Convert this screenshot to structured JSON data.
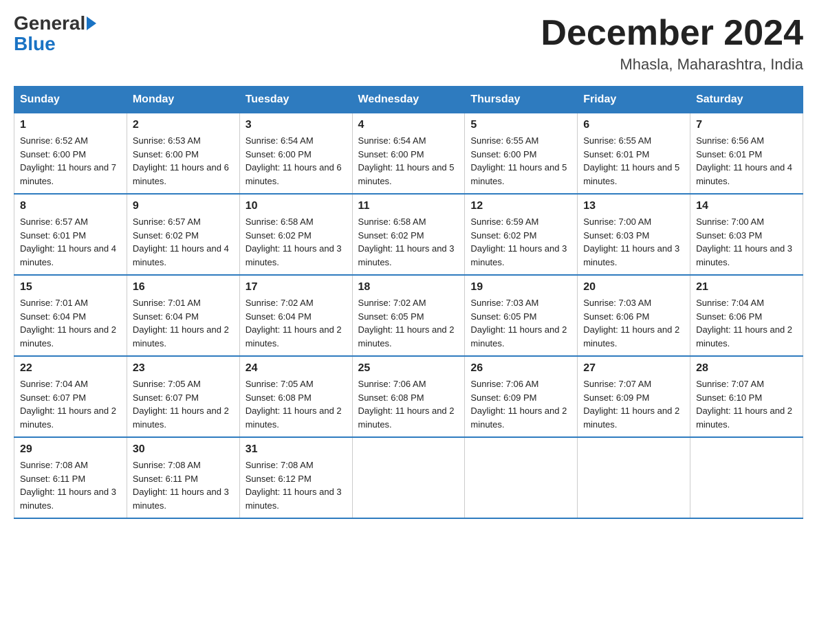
{
  "header": {
    "logo_general": "General",
    "logo_blue": "Blue",
    "title": "December 2024",
    "subtitle": "Mhasla, Maharashtra, India"
  },
  "days_of_week": [
    "Sunday",
    "Monday",
    "Tuesday",
    "Wednesday",
    "Thursday",
    "Friday",
    "Saturday"
  ],
  "weeks": [
    [
      {
        "day": "1",
        "sunrise": "6:52 AM",
        "sunset": "6:00 PM",
        "daylight": "11 hours and 7 minutes."
      },
      {
        "day": "2",
        "sunrise": "6:53 AM",
        "sunset": "6:00 PM",
        "daylight": "11 hours and 6 minutes."
      },
      {
        "day": "3",
        "sunrise": "6:54 AM",
        "sunset": "6:00 PM",
        "daylight": "11 hours and 6 minutes."
      },
      {
        "day": "4",
        "sunrise": "6:54 AM",
        "sunset": "6:00 PM",
        "daylight": "11 hours and 5 minutes."
      },
      {
        "day": "5",
        "sunrise": "6:55 AM",
        "sunset": "6:00 PM",
        "daylight": "11 hours and 5 minutes."
      },
      {
        "day": "6",
        "sunrise": "6:55 AM",
        "sunset": "6:01 PM",
        "daylight": "11 hours and 5 minutes."
      },
      {
        "day": "7",
        "sunrise": "6:56 AM",
        "sunset": "6:01 PM",
        "daylight": "11 hours and 4 minutes."
      }
    ],
    [
      {
        "day": "8",
        "sunrise": "6:57 AM",
        "sunset": "6:01 PM",
        "daylight": "11 hours and 4 minutes."
      },
      {
        "day": "9",
        "sunrise": "6:57 AM",
        "sunset": "6:02 PM",
        "daylight": "11 hours and 4 minutes."
      },
      {
        "day": "10",
        "sunrise": "6:58 AM",
        "sunset": "6:02 PM",
        "daylight": "11 hours and 3 minutes."
      },
      {
        "day": "11",
        "sunrise": "6:58 AM",
        "sunset": "6:02 PM",
        "daylight": "11 hours and 3 minutes."
      },
      {
        "day": "12",
        "sunrise": "6:59 AM",
        "sunset": "6:02 PM",
        "daylight": "11 hours and 3 minutes."
      },
      {
        "day": "13",
        "sunrise": "7:00 AM",
        "sunset": "6:03 PM",
        "daylight": "11 hours and 3 minutes."
      },
      {
        "day": "14",
        "sunrise": "7:00 AM",
        "sunset": "6:03 PM",
        "daylight": "11 hours and 3 minutes."
      }
    ],
    [
      {
        "day": "15",
        "sunrise": "7:01 AM",
        "sunset": "6:04 PM",
        "daylight": "11 hours and 2 minutes."
      },
      {
        "day": "16",
        "sunrise": "7:01 AM",
        "sunset": "6:04 PM",
        "daylight": "11 hours and 2 minutes."
      },
      {
        "day": "17",
        "sunrise": "7:02 AM",
        "sunset": "6:04 PM",
        "daylight": "11 hours and 2 minutes."
      },
      {
        "day": "18",
        "sunrise": "7:02 AM",
        "sunset": "6:05 PM",
        "daylight": "11 hours and 2 minutes."
      },
      {
        "day": "19",
        "sunrise": "7:03 AM",
        "sunset": "6:05 PM",
        "daylight": "11 hours and 2 minutes."
      },
      {
        "day": "20",
        "sunrise": "7:03 AM",
        "sunset": "6:06 PM",
        "daylight": "11 hours and 2 minutes."
      },
      {
        "day": "21",
        "sunrise": "7:04 AM",
        "sunset": "6:06 PM",
        "daylight": "11 hours and 2 minutes."
      }
    ],
    [
      {
        "day": "22",
        "sunrise": "7:04 AM",
        "sunset": "6:07 PM",
        "daylight": "11 hours and 2 minutes."
      },
      {
        "day": "23",
        "sunrise": "7:05 AM",
        "sunset": "6:07 PM",
        "daylight": "11 hours and 2 minutes."
      },
      {
        "day": "24",
        "sunrise": "7:05 AM",
        "sunset": "6:08 PM",
        "daylight": "11 hours and 2 minutes."
      },
      {
        "day": "25",
        "sunrise": "7:06 AM",
        "sunset": "6:08 PM",
        "daylight": "11 hours and 2 minutes."
      },
      {
        "day": "26",
        "sunrise": "7:06 AM",
        "sunset": "6:09 PM",
        "daylight": "11 hours and 2 minutes."
      },
      {
        "day": "27",
        "sunrise": "7:07 AM",
        "sunset": "6:09 PM",
        "daylight": "11 hours and 2 minutes."
      },
      {
        "day": "28",
        "sunrise": "7:07 AM",
        "sunset": "6:10 PM",
        "daylight": "11 hours and 2 minutes."
      }
    ],
    [
      {
        "day": "29",
        "sunrise": "7:08 AM",
        "sunset": "6:11 PM",
        "daylight": "11 hours and 3 minutes."
      },
      {
        "day": "30",
        "sunrise": "7:08 AM",
        "sunset": "6:11 PM",
        "daylight": "11 hours and 3 minutes."
      },
      {
        "day": "31",
        "sunrise": "7:08 AM",
        "sunset": "6:12 PM",
        "daylight": "11 hours and 3 minutes."
      },
      null,
      null,
      null,
      null
    ]
  ]
}
